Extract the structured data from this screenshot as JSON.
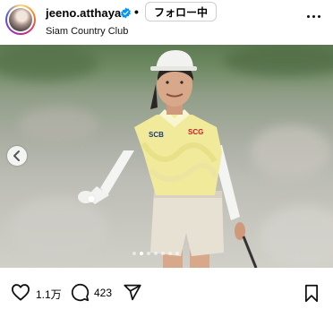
{
  "header": {
    "username": "jeeno.atthaya",
    "separator": "•",
    "follow_label": "フォロー中",
    "location": "Siam Country Club",
    "verified_color": "#0095f6"
  },
  "post": {
    "photo_icon": "golfer-photo",
    "logo_sponsor_left": "SCB",
    "logo_sponsor_right": "SCG",
    "carousel": {
      "total": 7,
      "current": 2
    }
  },
  "actions": {
    "like_count": "1.1万",
    "comment_count": "423"
  }
}
